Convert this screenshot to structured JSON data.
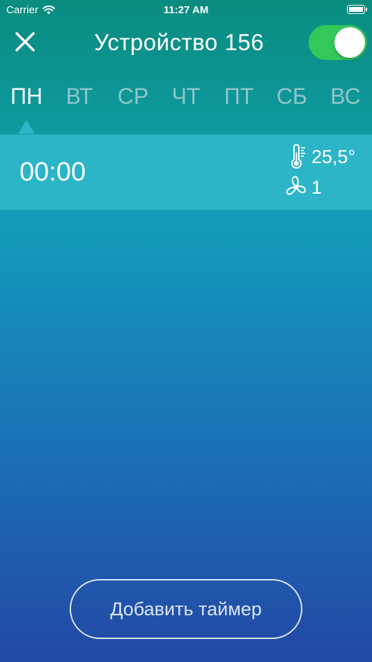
{
  "status_bar": {
    "carrier": "Carrier",
    "time": "11:27 AM"
  },
  "header": {
    "title": "Устройство 156",
    "power_toggle": {
      "on": true,
      "color": "#34c759"
    }
  },
  "days": {
    "selected": "ПН",
    "items": [
      "ПН",
      "ВТ",
      "СР",
      "ЧТ",
      "ПТ",
      "СБ",
      "ВС"
    ]
  },
  "timers": [
    {
      "time": "00:00",
      "temperature": "25,5°",
      "fan_speed": "1"
    }
  ],
  "add_timer_label": "Добавить таймер",
  "icons": {
    "close": "close-icon",
    "wifi": "wifi-icon",
    "battery": "battery-icon",
    "thermometer": "thermometer-icon",
    "fan": "fan-icon"
  }
}
